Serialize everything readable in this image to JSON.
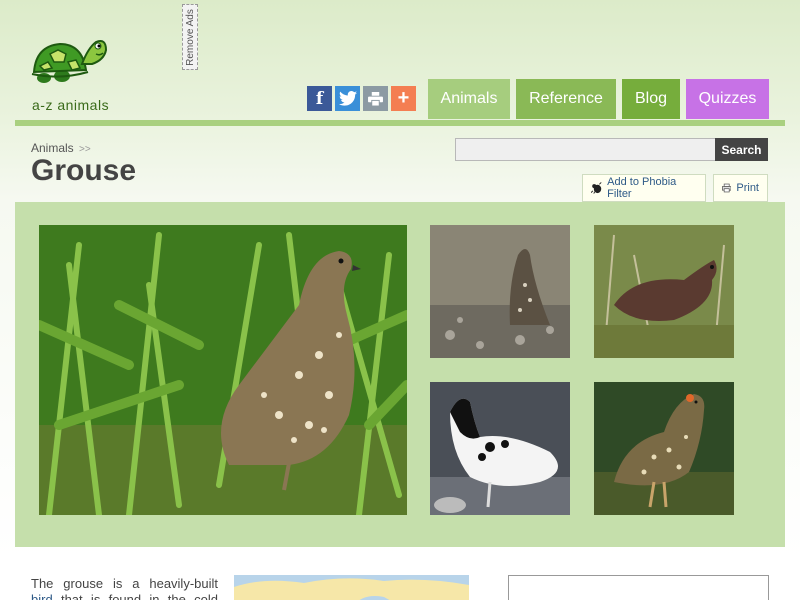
{
  "header": {
    "logo_text": "a-z animals",
    "remove_ads": "Remove Ads",
    "social": [
      {
        "name": "facebook-icon",
        "glyph": "f",
        "color": "#3b5998"
      },
      {
        "name": "twitter-icon",
        "color": "#3a8fd8"
      },
      {
        "name": "print-share-icon",
        "color": "#8c9aa3"
      },
      {
        "name": "plus-icon",
        "glyph": "+",
        "color": "#f47e52"
      }
    ],
    "nav": [
      {
        "label": "Animals",
        "color": "#a6cd7e"
      },
      {
        "label": "Reference",
        "color": "#8ab956"
      },
      {
        "label": "Blog",
        "color": "#76ad3c"
      },
      {
        "label": "Quizzes",
        "color": "#c772e6"
      }
    ]
  },
  "page": {
    "breadcrumb": "Animals",
    "breadcrumb_sep": ">>",
    "title": "Grouse",
    "search": {
      "value": "",
      "placeholder": "",
      "button": "Search"
    },
    "phobia_filter": "Add to Phobia Filter",
    "print": "Print"
  },
  "content": {
    "intro_line1": "The grouse is a heavily-built",
    "intro_link": "bird",
    "intro_line2_rest": " that is found in the cold"
  },
  "colors": {
    "accent_green": "#a9d07f",
    "gallery_bg": "#c5dfab",
    "link": "#2e5a87"
  }
}
